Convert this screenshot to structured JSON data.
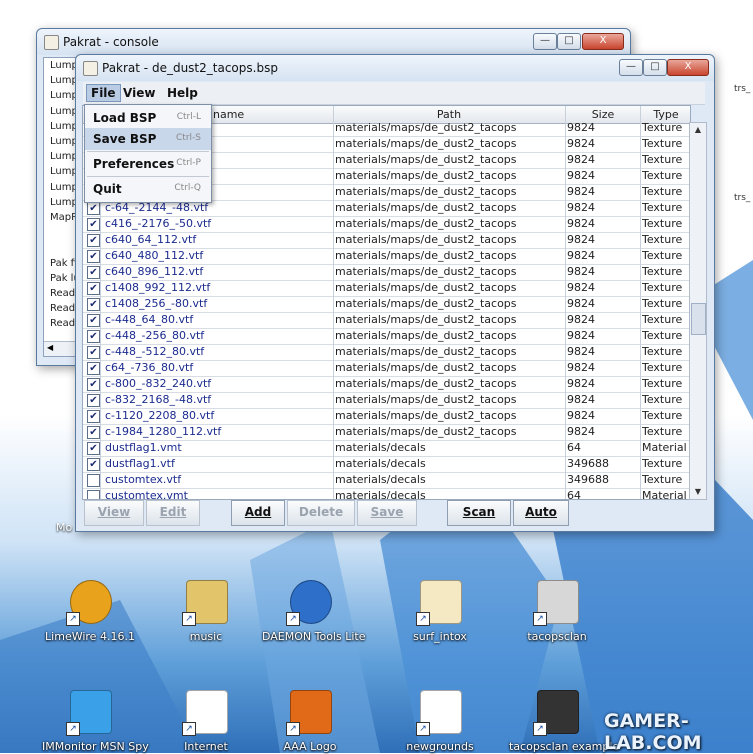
{
  "desktop": {
    "side_labels": [
      "trs_",
      "trs_"
    ],
    "icons": [
      {
        "label": "LimeWire 4.16.1",
        "icon": "limewire-icon"
      },
      {
        "label": "music",
        "icon": "folder-icon"
      },
      {
        "label": "DAEMON Tools Lite",
        "icon": "daemon-tools-icon"
      },
      {
        "label": "surf_intox",
        "icon": "half-life-map-icon"
      },
      {
        "label": "tacopsclan",
        "icon": "targa-file-icon"
      },
      {
        "label": "IMMonitor MSN Spy",
        "icon": "msn-monitor-icon"
      },
      {
        "label": "Internet",
        "icon": "internet-shortcut-icon"
      },
      {
        "label": "AAA Logo",
        "icon": "aaa-logo-icon"
      },
      {
        "label": "newgrounds",
        "icon": "mp3-file-icon"
      },
      {
        "label": "tacopsclan example",
        "icon": "image-thumbnail-icon"
      }
    ],
    "partial_label": "Mo",
    "watermark": "GAMER-LAB.COM"
  },
  "console_window": {
    "title": "Pakrat - console",
    "lines": [
      "Lump",
      "Lump",
      "Lump",
      "Lump",
      "Lump",
      "Lump",
      "Lump",
      "Lump",
      "Lump",
      "Lump",
      "MapRe",
      "",
      "",
      "Pak file",
      "Pak lu",
      "Readin",
      "Readin",
      "Readin"
    ]
  },
  "main_window": {
    "title": "Pakrat - de_dust2_tacops.bsp",
    "controls": {
      "minimize": "—",
      "maximize": "□",
      "close": "X"
    },
    "menus": [
      "File",
      "View",
      "Help"
    ],
    "file_menu": [
      {
        "label": "Load BSP",
        "accel": "Ctrl-L"
      },
      {
        "label": "Save BSP",
        "accel": "Ctrl-S"
      },
      {
        "label": "Preferences",
        "accel": "Ctrl-P"
      },
      {
        "label": "Quit",
        "accel": "Ctrl-Q"
      }
    ],
    "columns": {
      "name": "name",
      "path": "Path",
      "size": "Size",
      "type": "Type"
    },
    "rows": [
      {
        "checked": true,
        "name": "",
        "path": "materials/maps/de_dust2_tacops",
        "size": "9824",
        "type": "Texture"
      },
      {
        "checked": true,
        "name": "",
        "path": "materials/maps/de_dust2_tacops",
        "size": "9824",
        "type": "Texture"
      },
      {
        "checked": true,
        "name": "",
        "path": "materials/maps/de_dust2_tacops",
        "size": "9824",
        "type": "Texture"
      },
      {
        "checked": true,
        "name": "tf",
        "path": "materials/maps/de_dust2_tacops",
        "size": "9824",
        "type": "Texture"
      },
      {
        "checked": true,
        "name": "",
        "path": "materials/maps/de_dust2_tacops",
        "size": "9824",
        "type": "Texture"
      },
      {
        "checked": true,
        "name": "c-64_-2144_-48.vtf",
        "path": "materials/maps/de_dust2_tacops",
        "size": "9824",
        "type": "Texture"
      },
      {
        "checked": true,
        "name": "c416_-2176_-50.vtf",
        "path": "materials/maps/de_dust2_tacops",
        "size": "9824",
        "type": "Texture"
      },
      {
        "checked": true,
        "name": "c640_64_112.vtf",
        "path": "materials/maps/de_dust2_tacops",
        "size": "9824",
        "type": "Texture"
      },
      {
        "checked": true,
        "name": "c640_480_112.vtf",
        "path": "materials/maps/de_dust2_tacops",
        "size": "9824",
        "type": "Texture"
      },
      {
        "checked": true,
        "name": "c640_896_112.vtf",
        "path": "materials/maps/de_dust2_tacops",
        "size": "9824",
        "type": "Texture"
      },
      {
        "checked": true,
        "name": "c1408_992_112.vtf",
        "path": "materials/maps/de_dust2_tacops",
        "size": "9824",
        "type": "Texture"
      },
      {
        "checked": true,
        "name": "c1408_256_-80.vtf",
        "path": "materials/maps/de_dust2_tacops",
        "size": "9824",
        "type": "Texture"
      },
      {
        "checked": true,
        "name": "c-448_64_80.vtf",
        "path": "materials/maps/de_dust2_tacops",
        "size": "9824",
        "type": "Texture"
      },
      {
        "checked": true,
        "name": "c-448_-256_80.vtf",
        "path": "materials/maps/de_dust2_tacops",
        "size": "9824",
        "type": "Texture"
      },
      {
        "checked": true,
        "name": "c-448_-512_80.vtf",
        "path": "materials/maps/de_dust2_tacops",
        "size": "9824",
        "type": "Texture"
      },
      {
        "checked": true,
        "name": "c64_-736_80.vtf",
        "path": "materials/maps/de_dust2_tacops",
        "size": "9824",
        "type": "Texture"
      },
      {
        "checked": true,
        "name": "c-800_-832_240.vtf",
        "path": "materials/maps/de_dust2_tacops",
        "size": "9824",
        "type": "Texture"
      },
      {
        "checked": true,
        "name": "c-832_2168_-48.vtf",
        "path": "materials/maps/de_dust2_tacops",
        "size": "9824",
        "type": "Texture"
      },
      {
        "checked": true,
        "name": "c-1120_2208_80.vtf",
        "path": "materials/maps/de_dust2_tacops",
        "size": "9824",
        "type": "Texture"
      },
      {
        "checked": true,
        "name": "c-1984_1280_112.vtf",
        "path": "materials/maps/de_dust2_tacops",
        "size": "9824",
        "type": "Texture"
      },
      {
        "checked": true,
        "name": "dustflag1.vmt",
        "path": "materials/decals",
        "size": "64",
        "type": "Material"
      },
      {
        "checked": true,
        "name": "dustflag1.vtf",
        "path": "materials/decals",
        "size": "349688",
        "type": "Texture"
      },
      {
        "checked": false,
        "name": "customtex.vtf",
        "path": "materials/decals",
        "size": "349688",
        "type": "Texture"
      },
      {
        "checked": false,
        "name": "customtex.vmt",
        "path": "materials/decals",
        "size": "64",
        "type": "Material"
      }
    ],
    "buttons": [
      {
        "label": "View",
        "enabled": false
      },
      {
        "label": "Edit",
        "enabled": false
      },
      {
        "label": "Add",
        "enabled": true
      },
      {
        "label": "Delete",
        "enabled": false
      },
      {
        "label": "Save",
        "enabled": false
      },
      {
        "label": "Scan",
        "enabled": true
      },
      {
        "label": "Auto",
        "enabled": true
      }
    ]
  }
}
